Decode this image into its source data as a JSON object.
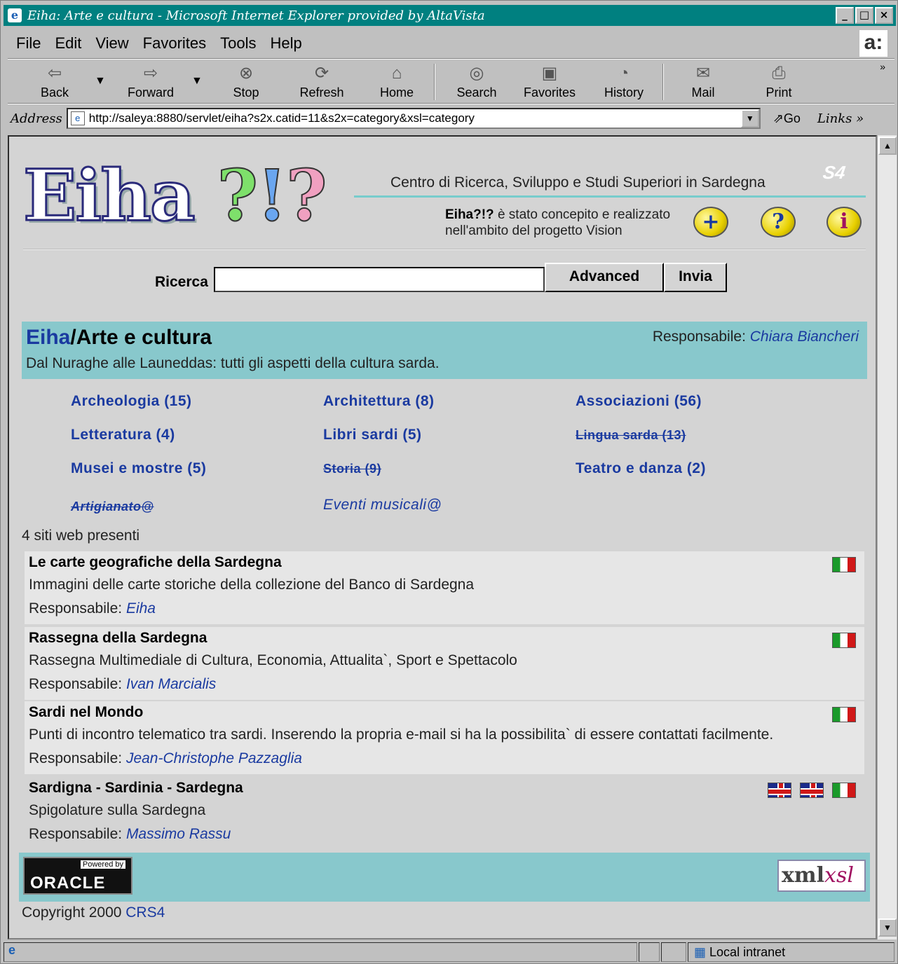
{
  "window": {
    "title": "Eiha: Arte e cultura - Microsoft Internet Explorer provided by AltaVista"
  },
  "menu": [
    "File",
    "Edit",
    "View",
    "Favorites",
    "Tools",
    "Help"
  ],
  "toolbar": {
    "back": "Back",
    "forward": "Forward",
    "stop": "Stop",
    "refresh": "Refresh",
    "home": "Home",
    "search": "Search",
    "favorites": "Favorites",
    "history": "History",
    "mail": "Mail",
    "print": "Print"
  },
  "address": {
    "label": "Address",
    "url": "http://saleya:8880/servlet/eiha?s2x.catid=11&s2x=category&xsl=category",
    "go": "Go",
    "links": "Links"
  },
  "header": {
    "centro": "Centro di Ricerca, Sviluppo e Studi Superiori in Sardegna",
    "eiha_bold": "Eiha?!?",
    "eiha_line1": " è stato concepito e realizzato",
    "eiha_line2": "nell'ambito del progetto Vision"
  },
  "search": {
    "label": "Ricerca",
    "value": "",
    "advanced": "Advanced",
    "invia": "Invia"
  },
  "category": {
    "root": "Eiha",
    "name": "Arte e cultura",
    "description": "Dal Nuraghe alle Launeddas: tutti gli aspetti della cultura sarda.",
    "resp_label": "Responsabile:",
    "resp_name": "Chiara Biancheri"
  },
  "subcategories": [
    {
      "label": "Archeologia (15)"
    },
    {
      "label": "Architettura (8)"
    },
    {
      "label": "Associazioni (56)"
    },
    {
      "label": "Letteratura (4)"
    },
    {
      "label": "Libri sardi (5)"
    },
    {
      "label": "Lingua sarda (13)"
    },
    {
      "label": "Musei e mostre (5)"
    },
    {
      "label": "Storia (9)"
    },
    {
      "label": "Teatro e danza (2)"
    },
    {
      "label": "Artigianato@"
    },
    {
      "label": "Eventi musicali@"
    }
  ],
  "count_text": "4 siti web presenti",
  "sites": [
    {
      "title": "Le carte geografiche della Sardegna",
      "desc": "Immagini delle carte storiche della collezione del Banco di Sardegna",
      "resp_label": "Responsabile:",
      "resp": "Eiha"
    },
    {
      "title": "Rassegna della Sardegna",
      "desc": "Rassegna Multimediale di Cultura, Economia, Attualita`, Sport e Spettacolo",
      "resp_label": "Responsabile:",
      "resp": "Ivan Marcialis"
    },
    {
      "title": "Sardi nel Mondo",
      "desc": "Punti di incontro telematico tra sardi. Inserendo la propria e-mail si ha la possibilita` di essere contattati facilmente.",
      "resp_label": "Responsabile:",
      "resp": "Jean-Christophe Pazzaglia"
    },
    {
      "title": "Sardigna - Sardinia - Sardegna",
      "desc": "Spigolature sulla Sardegna",
      "resp_label": "Responsabile:",
      "resp": "Massimo Rassu"
    }
  ],
  "footer": {
    "powered": "Powered by",
    "oracle": "ORACLE",
    "xml": "xml",
    "xsl": "xsl",
    "copyright": "Copyright 2000 ",
    "crs4": "CRS4"
  },
  "status": {
    "zone": "Local intranet"
  }
}
